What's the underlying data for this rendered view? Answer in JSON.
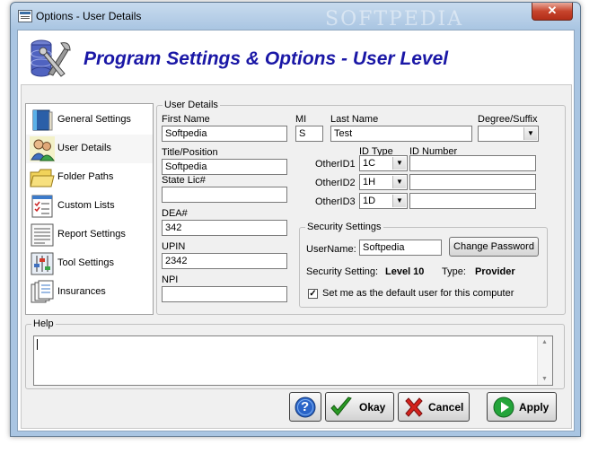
{
  "window": {
    "title": "Options - User Details",
    "close_symbol": "✕",
    "watermark": "SOFTPEDIA"
  },
  "header": {
    "title": "Program Settings & Options - User Level",
    "icon": "database-tools-icon"
  },
  "sidebar": {
    "items": [
      {
        "label": "General Settings",
        "icon": "book-icon"
      },
      {
        "label": "User Details",
        "icon": "users-icon"
      },
      {
        "label": "Folder Paths",
        "icon": "folder-icon"
      },
      {
        "label": "Custom Lists",
        "icon": "checklist-icon"
      },
      {
        "label": "Report Settings",
        "icon": "report-icon"
      },
      {
        "label": "Tool Settings",
        "icon": "sliders-icon"
      },
      {
        "label": "Insurances",
        "icon": "documents-icon"
      }
    ]
  },
  "user_details": {
    "group_title": "User Details",
    "first_name": {
      "label": "First Name",
      "value": "Softpedia"
    },
    "mi": {
      "label": "MI",
      "value": "S"
    },
    "last_name": {
      "label": "Last Name",
      "value": "Test"
    },
    "degree": {
      "label": "Degree/Suffix",
      "value": ""
    },
    "title": {
      "label": "Title/Position",
      "value": "Softpedia"
    },
    "state_lic": {
      "label": "State Lic#",
      "value": ""
    },
    "dea": {
      "label": "DEA#",
      "value": "342"
    },
    "upin": {
      "label": "UPIN",
      "value": "2342"
    },
    "npi": {
      "label": "NPI",
      "value": ""
    },
    "id_type_header": "ID Type",
    "id_number_header": "ID Number",
    "other_ids": [
      {
        "label": "OtherID1",
        "type": "1C",
        "number": ""
      },
      {
        "label": "OtherID2",
        "type": "1H",
        "number": ""
      },
      {
        "label": "OtherID3",
        "type": "1D",
        "number": ""
      }
    ]
  },
  "security": {
    "group_title": "Security Settings",
    "username_label": "UserName:",
    "username_value": "Softpedia",
    "change_password": "Change Password",
    "setting_label": "Security Setting:",
    "setting_value": "Level 10",
    "type_label": "Type:",
    "type_value": "Provider",
    "default_user_label": "Set me as the default user for this computer",
    "default_user_checked": true
  },
  "help": {
    "group_title": "Help",
    "text": ""
  },
  "buttons": {
    "help_symbol": "?",
    "okay": "Okay",
    "cancel": "Cancel",
    "apply": "Apply"
  },
  "colors": {
    "title_blue": "#1a17a6",
    "okay_green": "#2a9a24",
    "cancel_red": "#d4221c",
    "apply_green": "#23a43a"
  }
}
